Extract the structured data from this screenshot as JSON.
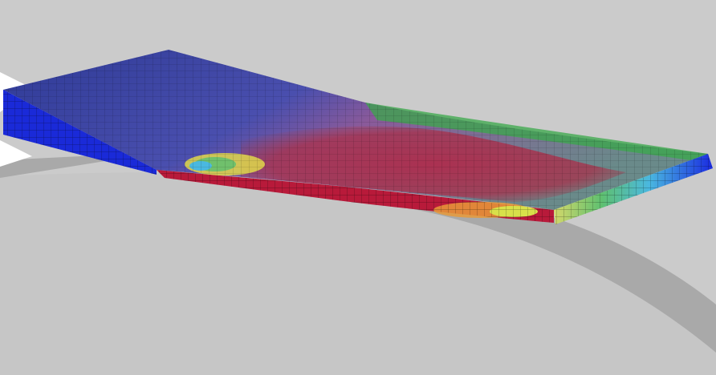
{
  "scene": {
    "type": "fea-deformed-mesh-render",
    "colors": {
      "background": "#cbcbcb",
      "floor_light": "#c4c4c4",
      "floor_shadow": "#a8a8a8",
      "mesh_base": "#2a3a9a",
      "mesh_top": "#3a4aa8",
      "mesh_side": "#0a1ad0",
      "mesh_lines": "#000000",
      "contour_blue": "#2233cc",
      "contour_cyan": "#4fc3e8",
      "contour_green": "#3aa84a",
      "contour_yellow": "#e6e04a",
      "contour_orange": "#e89030",
      "contour_red": "#c81a3a"
    }
  }
}
